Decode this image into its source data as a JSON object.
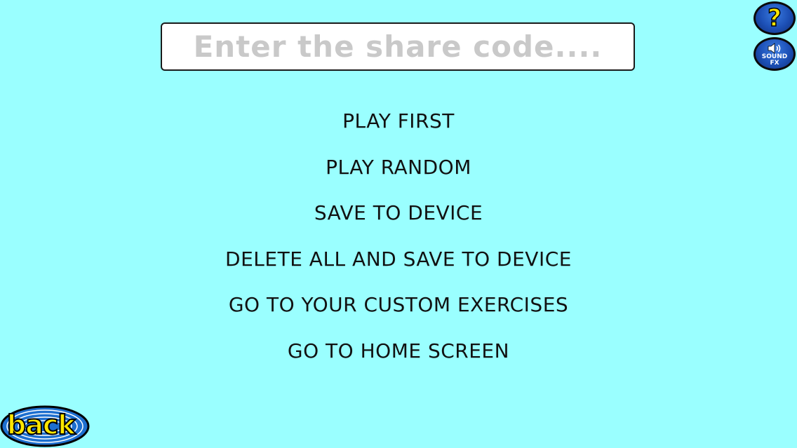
{
  "share": {
    "placeholder": "Enter the share code....",
    "value": ""
  },
  "menu": {
    "items": [
      {
        "label": "PLAY FIRST"
      },
      {
        "label": "PLAY RANDOM"
      },
      {
        "label": "SAVE TO DEVICE"
      },
      {
        "label": "DELETE ALL AND SAVE TO DEVICE"
      },
      {
        "label": "GO TO YOUR CUSTOM EXERCISES"
      },
      {
        "label": "GO TO HOME SCREEN"
      }
    ]
  },
  "top_right": {
    "help": {
      "icon": "question-mark-icon",
      "glyph": "?"
    },
    "sound": {
      "icon": "speaker-icon",
      "label_line1": "SOUND",
      "label_line2": "FX"
    }
  },
  "back": {
    "label": "back",
    "icon": "back-badge"
  },
  "colors": {
    "background": "#9affff",
    "button_blue": "#1c4fb5",
    "accent_yellow": "#ffe600",
    "placeholder_gray": "#c9c9c9"
  }
}
